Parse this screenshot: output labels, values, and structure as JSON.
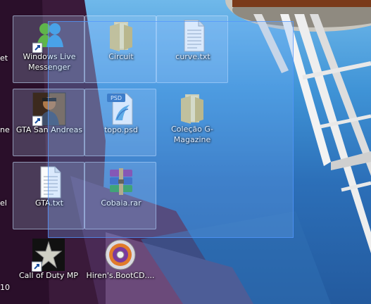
{
  "icons": {
    "messenger": {
      "label": "Windows Live Messenger"
    },
    "circuit": {
      "label": "Circuit"
    },
    "curve_txt": {
      "label": "curve.txt"
    },
    "gta_sa": {
      "label": "GTA San Andreas"
    },
    "topo_psd": {
      "label": "topo.psd"
    },
    "colecao": {
      "label": "Coleção G-Magazine"
    },
    "gta_txt": {
      "label": "GTA.txt"
    },
    "cobaia": {
      "label": "Cobaia.rar"
    },
    "cod": {
      "label": "Call of Duty MP"
    },
    "hirens": {
      "label": "Hiren's.BootCD...."
    }
  },
  "left_cut_labels": [
    "et",
    "ne",
    "el",
    "10"
  ],
  "psd_badge": "PSD",
  "colors": {
    "sky_top": "#6fb8ea",
    "sky_bottom": "#235a9e",
    "selection_fill": "#78b4ff",
    "selection_border": "#5096ff"
  }
}
